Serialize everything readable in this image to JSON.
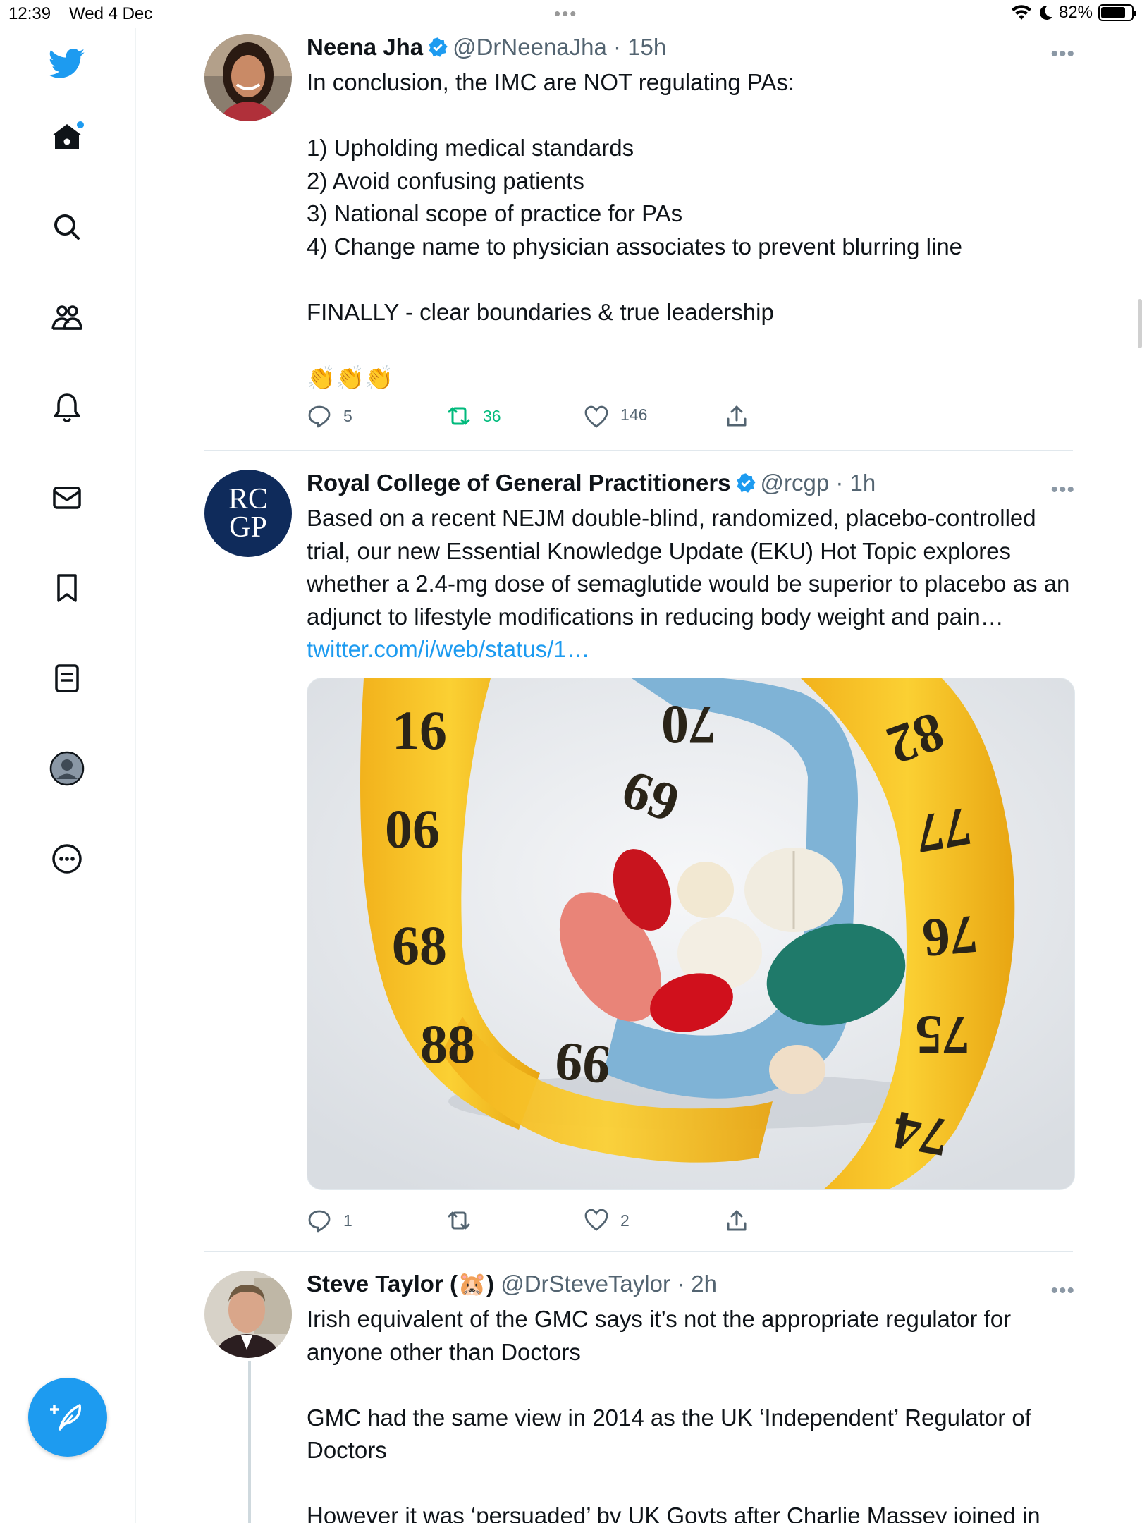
{
  "status_bar": {
    "time": "12:39",
    "date": "Wed 4 Dec",
    "battery": "82%",
    "battery_level": 0.82
  },
  "sidebar": {
    "items": [
      {
        "icon": "twitter-bird-icon",
        "label": "Twitter"
      },
      {
        "icon": "home-icon",
        "label": "Home"
      },
      {
        "icon": "search-icon",
        "label": "Explore"
      },
      {
        "icon": "communities-icon",
        "label": "Communities"
      },
      {
        "icon": "bell-icon",
        "label": "Notifications"
      },
      {
        "icon": "mail-icon",
        "label": "Messages"
      },
      {
        "icon": "bookmark-icon",
        "label": "Bookmarks"
      },
      {
        "icon": "lists-icon",
        "label": "Lists"
      },
      {
        "icon": "profile-icon",
        "label": "Profile"
      },
      {
        "icon": "more-circle-icon",
        "label": "More"
      }
    ],
    "compose_icon": "compose-feather-icon"
  },
  "colors": {
    "accent": "#1d9bf0",
    "retweet_active": "#00ba7c",
    "secondary_text": "#536471",
    "rcgp_navy": "#0f2b5b"
  },
  "tweets": [
    {
      "name": "Neena Jha",
      "verified": true,
      "handle": "@DrNeenaJha",
      "time": "15h",
      "text": "In conclusion, the IMC are NOT regulating PAs:\n\n1) Upholding medical standards\n2) Avoid confusing patients\n3) National scope of practice for PAs\n4) Change name to physician associates to prevent blurring line\n\nFINALLY - clear boundaries & true leadership\n\n👏👏👏",
      "replies": "5",
      "retweets": "36",
      "likes": "146"
    },
    {
      "name": "Royal College of General Practitioners",
      "verified": true,
      "handle": "@rcgp",
      "time": "1h",
      "avatar_text_1": "RC",
      "avatar_text_2": "GP",
      "text": "Based on a recent NEJM double-blind, randomized, placebo-controlled trial, our new Essential Knowledge Update (EKU) Hot Topic explores whether a 2.4-mg dose of semaglutide would be superior to placebo as an adjunct to lifestyle modifications in reducing body weight and pain…",
      "link": "twitter.com/i/web/status/1…",
      "tape_numbers": [
        "16",
        "06",
        "68",
        "88",
        "69",
        "70",
        "82",
        "77",
        "76",
        "75",
        "74",
        "99"
      ],
      "replies": "1",
      "retweets": "",
      "likes": "2"
    },
    {
      "name": "Steve Taylor (🐹)",
      "verified": false,
      "handle": "@DrSteveTaylor",
      "time": "2h",
      "text": "Irish equivalent of the GMC says it’s not the appropriate regulator for anyone other than Doctors\n\nGMC had the same view in 2014 as the UK ‘Independent’ Regulator of Doctors\n\nHowever it was ‘persuaded’ by UK Govts after Charlie Massey joined in"
    }
  ]
}
